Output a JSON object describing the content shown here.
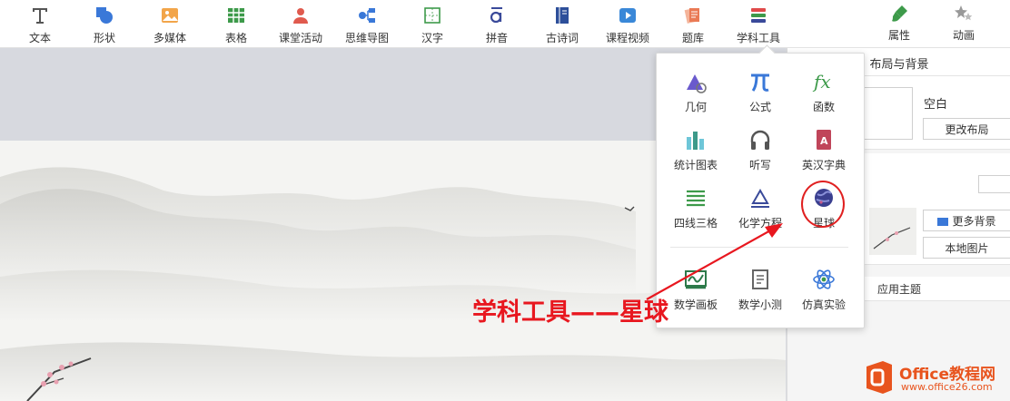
{
  "toolbar": {
    "items": [
      {
        "label": "文本",
        "icon": "text-icon"
      },
      {
        "label": "形状",
        "icon": "shape-icon"
      },
      {
        "label": "多媒体",
        "icon": "image-icon"
      },
      {
        "label": "表格",
        "icon": "table-icon"
      },
      {
        "label": "课堂活动",
        "icon": "classroom-activity-icon"
      },
      {
        "label": "思维导图",
        "icon": "mindmap-icon"
      },
      {
        "label": "汉字",
        "icon": "hanzi-icon"
      },
      {
        "label": "拼音",
        "icon": "pinyin-icon"
      },
      {
        "label": "古诗词",
        "icon": "poem-book-icon"
      },
      {
        "label": "课程视频",
        "icon": "video-icon"
      },
      {
        "label": "题库",
        "icon": "question-bank-icon"
      },
      {
        "label": "学科工具",
        "icon": "subject-tools-icon"
      }
    ]
  },
  "panel_tabs": {
    "properties": "属性",
    "animation": "动画"
  },
  "side_panel": {
    "layout_title": "布局与背景",
    "blank_label": "空白",
    "change_layout": "更改布局",
    "more_backgrounds": "更多背景",
    "local_image": "本地图片",
    "apply_theme": "应用主题"
  },
  "dropdown": {
    "items": [
      {
        "label": "几何",
        "icon": "geometry-icon"
      },
      {
        "label": "公式",
        "icon": "pi-formula-icon"
      },
      {
        "label": "函数",
        "icon": "function-fx-icon"
      },
      {
        "label": "统计图表",
        "icon": "bar-chart-icon"
      },
      {
        "label": "听写",
        "icon": "headphones-icon"
      },
      {
        "label": "英汉字典",
        "icon": "dictionary-icon"
      },
      {
        "label": "四线三格",
        "icon": "four-lines-icon"
      },
      {
        "label": "化学方程",
        "icon": "chemistry-equation-icon"
      },
      {
        "label": "星球",
        "icon": "planet-icon"
      },
      {
        "label": "数学画板",
        "icon": "math-board-icon"
      },
      {
        "label": "数学小测",
        "icon": "math-quiz-icon"
      },
      {
        "label": "仿真实验",
        "icon": "atom-icon"
      }
    ]
  },
  "annotation": {
    "text": "学科工具——星球",
    "color": "#e8171f"
  },
  "watermark": {
    "brand": "Office教程网",
    "url": "www.office26.com",
    "color": "#e8541e"
  },
  "colors": {
    "accent_blue": "#3a78d8",
    "accent_green": "#3d9a4a",
    "canvas_gray": "#d7d9df"
  }
}
